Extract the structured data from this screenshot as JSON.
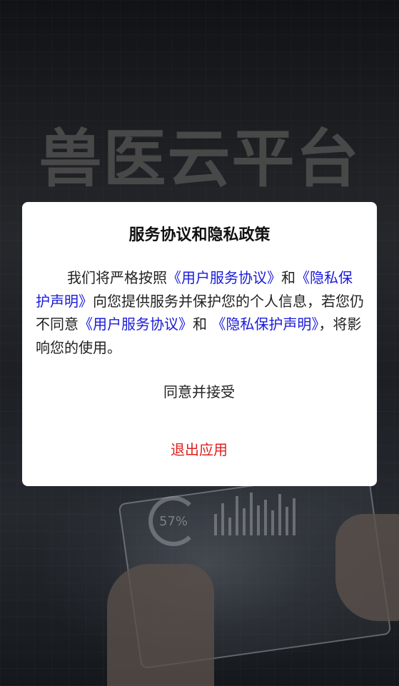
{
  "background": {
    "hero_title": "兽医云平台",
    "gauge_value": "57%"
  },
  "dialog": {
    "title": "服务协议和隐私政策",
    "body_text_1": "我们将严格按照",
    "link_user_agreement_1": "《用户服务协议》",
    "body_text_2": "和",
    "link_privacy_1": "《隐私保护声明》",
    "body_text_3": "向您提供服务并保护您的个人信息，若您仍不同意",
    "link_user_agreement_2": "《用户服务协议》",
    "body_text_4": "和 ",
    "link_privacy_2": "《隐私保护声明》",
    "body_text_5": "，将影响您的使用。",
    "agree_label": "同意并接受",
    "exit_label": "退出应用"
  },
  "colors": {
    "link": "#1a1adb",
    "exit": "#e02020",
    "dialog_bg": "#ffffff"
  }
}
